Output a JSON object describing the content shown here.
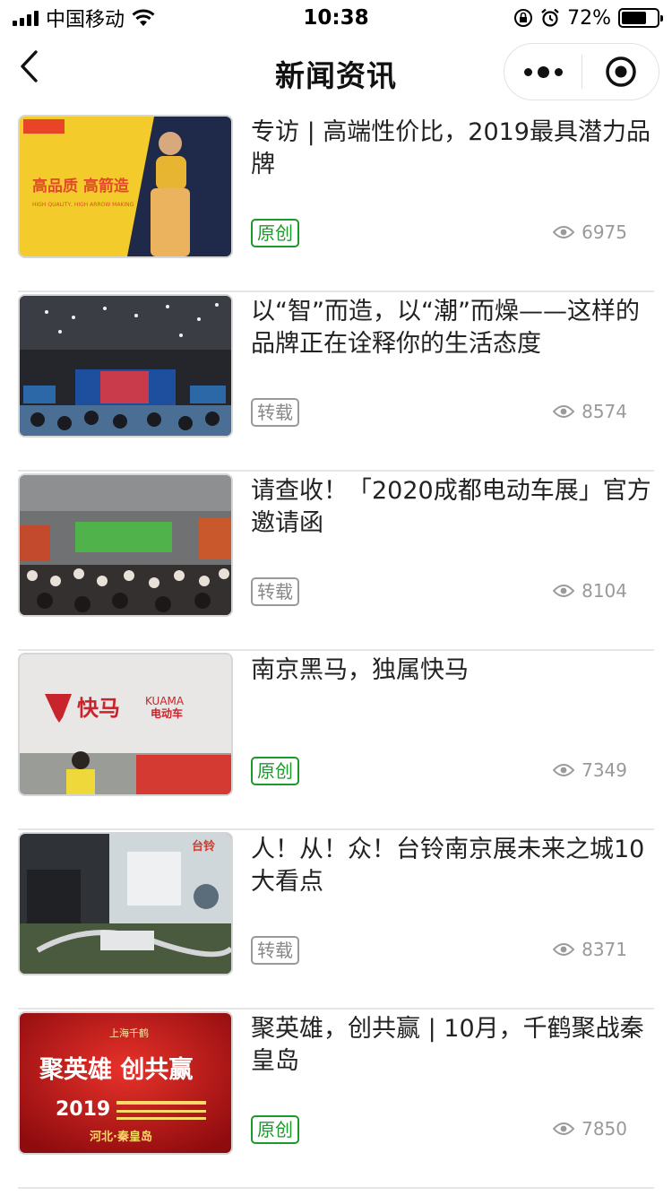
{
  "status_bar": {
    "carrier": "中国移动",
    "time": "10:38",
    "battery_percent": "72%",
    "battery_level": 0.72
  },
  "nav": {
    "title": "新闻资讯"
  },
  "colors": {
    "original_tag": "#1a9a2a",
    "repost_tag": "#888888",
    "divider": "#e6e6e6"
  },
  "news": [
    {
      "title": "专访 | 高端性价比，2019最具潜力品牌",
      "tag": "原创",
      "views": "6975",
      "thumbnail_text": [
        "高品质 高箭造",
        "HIGH QUALITY, HIGH ARROW MAKING"
      ]
    },
    {
      "title": "以“智”而造，以“潮”而燥——这样的品牌正在诠释你的生活态度",
      "tag": "转载",
      "views": "8574"
    },
    {
      "title": "请查收！「2020成都电动车展」官方邀请函",
      "tag": "转载",
      "views": "8104"
    },
    {
      "title": "南京黑马，独属快马",
      "tag": "原创",
      "views": "7349",
      "thumbnail_text": [
        "快马",
        "KUAMA",
        "电动车"
      ]
    },
    {
      "title": "人！从！众！台铃南京展未来之城10大看点",
      "tag": "转载",
      "views": "8371",
      "thumbnail_text": [
        "台铃"
      ]
    },
    {
      "title": "聚英雄，创共赢 | 10月，千鹤聚战秦皇岛",
      "tag": "原创",
      "views": "7850",
      "thumbnail_text": [
        "上海千鹤",
        "聚英雄 创共赢",
        "2019",
        "河北·秦皇岛"
      ]
    }
  ]
}
